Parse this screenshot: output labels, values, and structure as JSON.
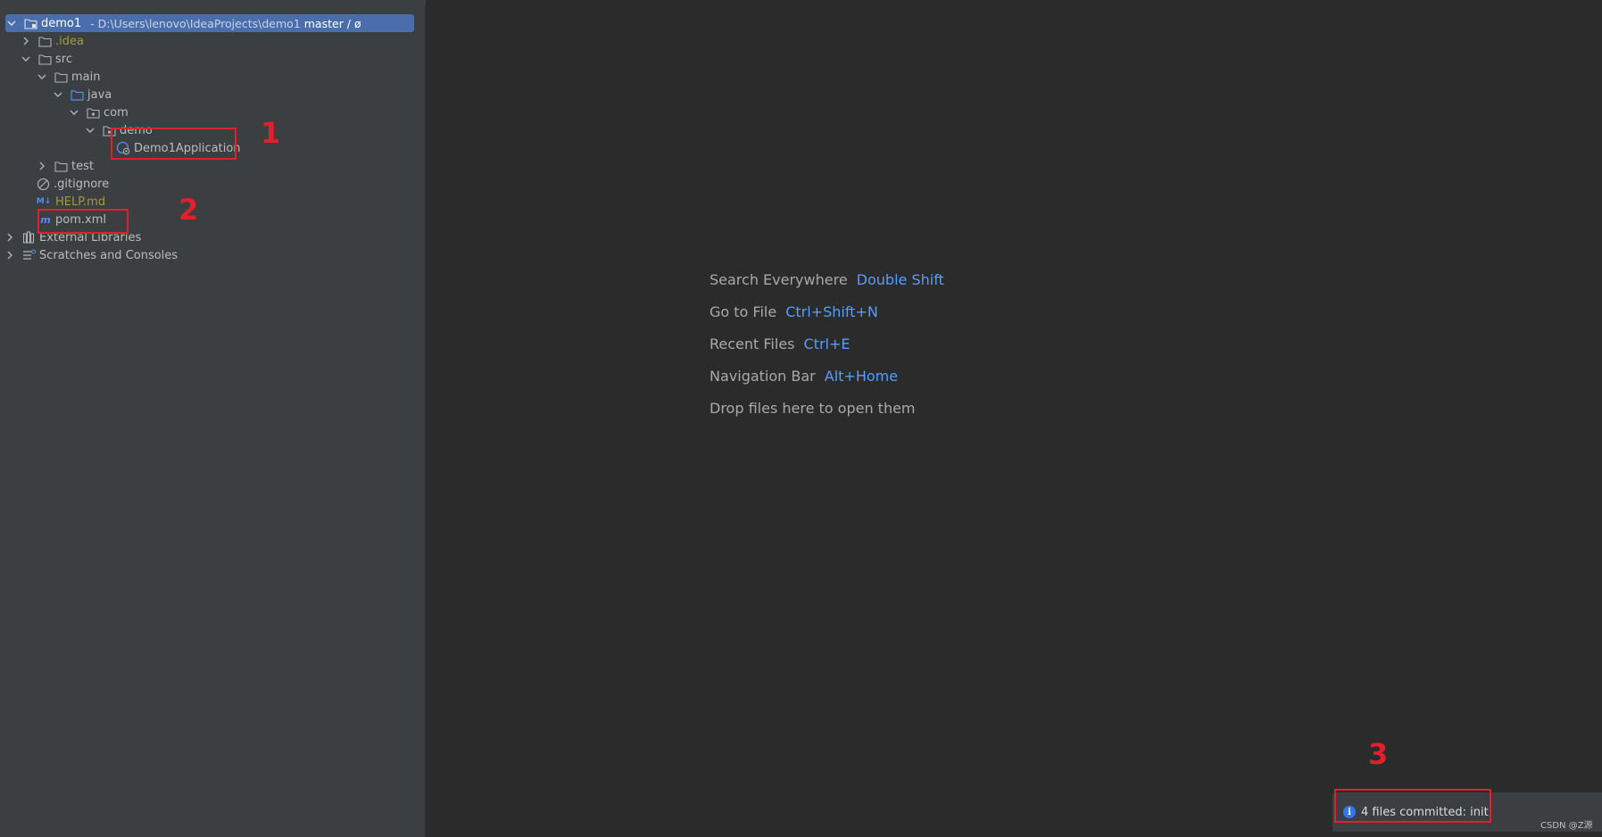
{
  "project_tree": {
    "root": {
      "name": "demo1",
      "path": "- D:\\Users\\lenovo\\IdeaProjects\\demo1",
      "branch": "master / ø"
    },
    "items": [
      {
        "label": ".idea"
      },
      {
        "label": "src"
      },
      {
        "label": "main"
      },
      {
        "label": "java"
      },
      {
        "label": "com"
      },
      {
        "label": "demo"
      },
      {
        "label": "Demo1Application"
      },
      {
        "label": "test"
      },
      {
        "label": ".gitignore"
      },
      {
        "label": "HELP.md"
      },
      {
        "label": "pom.xml"
      },
      {
        "label": "External Libraries"
      },
      {
        "label": "Scratches and Consoles"
      }
    ]
  },
  "annotations": {
    "n1": "1",
    "n2": "2",
    "n3": "3"
  },
  "editor_hints": [
    {
      "text": "Search Everywhere",
      "key": "Double Shift"
    },
    {
      "text": "Go to File",
      "key": "Ctrl+Shift+N"
    },
    {
      "text": "Recent Files",
      "key": "Ctrl+E"
    },
    {
      "text": "Navigation Bar",
      "key": "Alt+Home"
    },
    {
      "text": "Drop files here to open them",
      "key": ""
    }
  ],
  "notification": {
    "text": "4 files committed: init",
    "icon": "info-icon"
  },
  "watermark": "CSDN @Z源",
  "colors": {
    "selection": "#4a6eab",
    "accent_key": "#589df6",
    "annotation_red": "#e0202a"
  }
}
